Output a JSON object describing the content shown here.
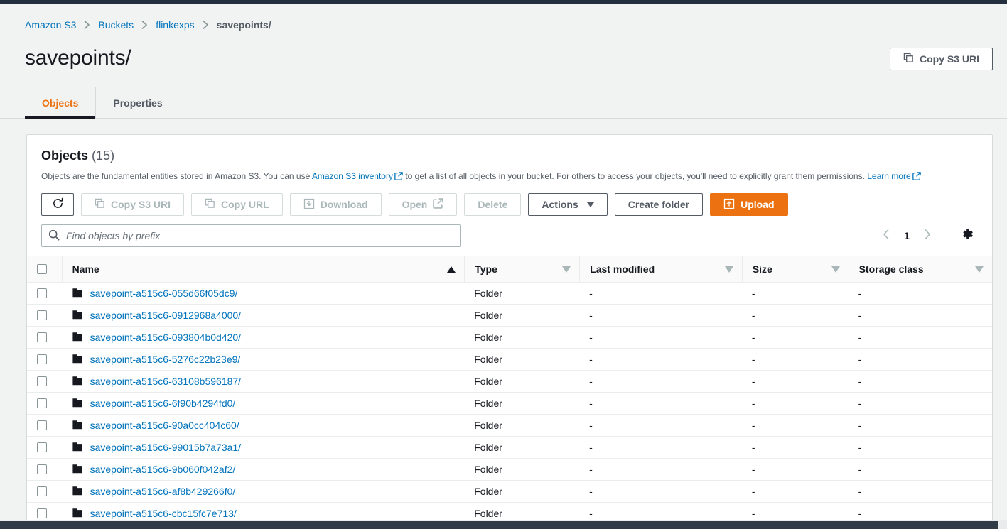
{
  "breadcrumb": {
    "items": [
      {
        "label": "Amazon S3",
        "link": true
      },
      {
        "label": "Buckets",
        "link": true
      },
      {
        "label": "flinkexps",
        "link": true
      },
      {
        "label": "savepoints/",
        "link": false
      }
    ]
  },
  "header": {
    "title": "savepoints/",
    "copy_s3_uri_label": "Copy S3 URI",
    "copy_icon": "copy-icon"
  },
  "tabs": [
    {
      "label": "Objects",
      "active": true
    },
    {
      "label": "Properties",
      "active": false
    }
  ],
  "objects_panel": {
    "title": "Objects",
    "count": "(15)",
    "description_part1": "Objects are the fundamental entities stored in Amazon S3. You can use ",
    "inventory_link": "Amazon S3 inventory",
    "description_part2": " to get a list of all objects in your bucket. For others to access your objects, you'll need to explicitly grant them permissions. ",
    "learn_more_link": "Learn more"
  },
  "toolbar": {
    "refresh_icon": "refresh-icon",
    "copy_s3_uri_label": "Copy S3 URI",
    "copy_url_label": "Copy URL",
    "download_label": "Download",
    "open_label": "Open",
    "delete_label": "Delete",
    "actions_label": "Actions",
    "create_folder_label": "Create folder",
    "upload_label": "Upload"
  },
  "search": {
    "placeholder": "Find objects by prefix",
    "value": ""
  },
  "pagination": {
    "prev_icon": "chevron-left-icon",
    "page": "1",
    "next_icon": "chevron-right-icon",
    "settings_icon": "gear-icon"
  },
  "table": {
    "columns": [
      {
        "label": "Name",
        "sort": "asc"
      },
      {
        "label": "Type",
        "sort": "none"
      },
      {
        "label": "Last modified",
        "sort": "none"
      },
      {
        "label": "Size",
        "sort": "none"
      },
      {
        "label": "Storage class",
        "sort": "none"
      }
    ],
    "rows": [
      {
        "name": "savepoint-a515c6-055d66f05dc9/",
        "type": "Folder",
        "last_modified": "-",
        "size": "-",
        "storage_class": "-"
      },
      {
        "name": "savepoint-a515c6-0912968a4000/",
        "type": "Folder",
        "last_modified": "-",
        "size": "-",
        "storage_class": "-"
      },
      {
        "name": "savepoint-a515c6-093804b0d420/",
        "type": "Folder",
        "last_modified": "-",
        "size": "-",
        "storage_class": "-"
      },
      {
        "name": "savepoint-a515c6-5276c22b23e9/",
        "type": "Folder",
        "last_modified": "-",
        "size": "-",
        "storage_class": "-"
      },
      {
        "name": "savepoint-a515c6-63108b596187/",
        "type": "Folder",
        "last_modified": "-",
        "size": "-",
        "storage_class": "-"
      },
      {
        "name": "savepoint-a515c6-6f90b4294fd0/",
        "type": "Folder",
        "last_modified": "-",
        "size": "-",
        "storage_class": "-"
      },
      {
        "name": "savepoint-a515c6-90a0cc404c60/",
        "type": "Folder",
        "last_modified": "-",
        "size": "-",
        "storage_class": "-"
      },
      {
        "name": "savepoint-a515c6-99015b7a73a1/",
        "type": "Folder",
        "last_modified": "-",
        "size": "-",
        "storage_class": "-"
      },
      {
        "name": "savepoint-a515c6-9b060f042af2/",
        "type": "Folder",
        "last_modified": "-",
        "size": "-",
        "storage_class": "-"
      },
      {
        "name": "savepoint-a515c6-af8b429266f0/",
        "type": "Folder",
        "last_modified": "-",
        "size": "-",
        "storage_class": "-"
      },
      {
        "name": "savepoint-a515c6-cbc15fc7e713/",
        "type": "Folder",
        "last_modified": "-",
        "size": "-",
        "storage_class": "-"
      }
    ]
  },
  "colors": {
    "accent_orange": "#ec7211",
    "link_blue": "#0073bb",
    "dark_navy": "#232f3e",
    "text": "#16191f",
    "muted": "#545b64"
  }
}
